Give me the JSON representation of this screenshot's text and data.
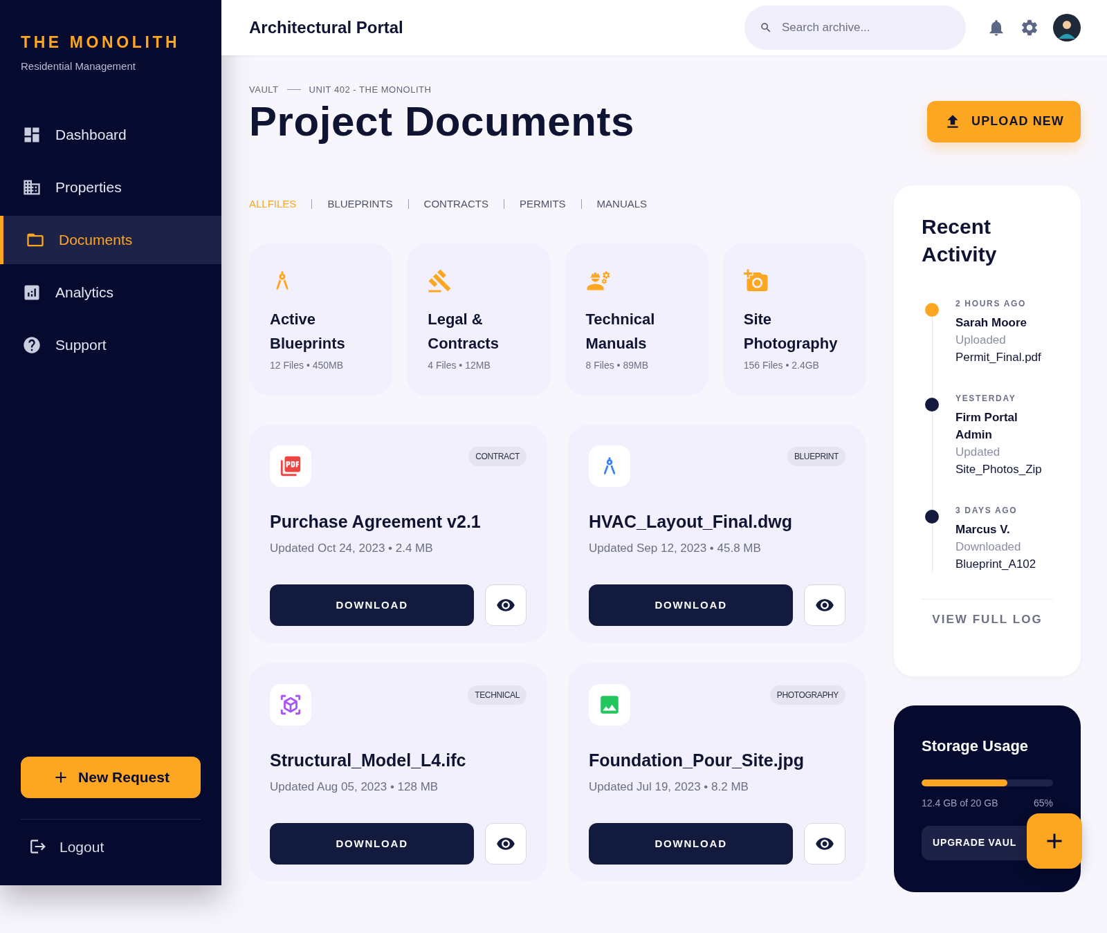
{
  "brand": {
    "title": "THE MONOLITH",
    "subtitle": "Residential Management"
  },
  "nav": [
    {
      "label": "Dashboard",
      "kind": "dashboard",
      "selected": false
    },
    {
      "label": "Properties",
      "kind": "properties",
      "selected": false
    },
    {
      "label": "Documents",
      "kind": "documents",
      "selected": true
    },
    {
      "label": "Analytics",
      "kind": "analytics",
      "selected": false
    },
    {
      "label": "Support",
      "kind": "support",
      "selected": false
    }
  ],
  "new_request": "New Request",
  "logout": "Logout",
  "header": {
    "title": "Architectural Portal",
    "search": {
      "placeholder": "Search archive..."
    }
  },
  "breadcrumb": [
    "VAULT",
    "UNIT 402 - THE MONOLITH"
  ],
  "page_title": "Project Documents",
  "upload_button": "UPLOAD NEW",
  "filters": [
    {
      "label": "ALLFILES",
      "selected": true
    },
    {
      "label": "BLUEPRINTS",
      "selected": false
    },
    {
      "label": "CONTRACTS",
      "selected": false
    },
    {
      "label": "PERMITS",
      "selected": false
    },
    {
      "label": "MANUALS",
      "selected": false
    }
  ],
  "categories": [
    {
      "kind": "blueprint",
      "title": "Active Blueprints",
      "meta": "12 Files • 450MB"
    },
    {
      "kind": "legal",
      "title": "Legal & Contracts",
      "meta": "4 Files • 12MB"
    },
    {
      "kind": "technical",
      "title": "Technical Manuals",
      "meta": "8 Files • 89MB"
    },
    {
      "kind": "photo",
      "title": "Site Photography",
      "meta": "156 Files • 2.4GB"
    }
  ],
  "documents": [
    {
      "kind": "pdf",
      "tag": "CONTRACT",
      "name": "Purchase Agreement v2.1",
      "meta": "Updated Oct 24, 2023 • 2.4 MB",
      "action": "DOWNLOAD"
    },
    {
      "kind": "blueprint",
      "tag": "BLUEPRINT",
      "name": "HVAC_Layout_Final.dwg",
      "meta": "Updated Sep 12, 2023 • 45.8 MB",
      "action": "DOWNLOAD"
    },
    {
      "kind": "model",
      "tag": "TECHNICAL",
      "name": "Structural_Model_L4.ifc",
      "meta": "Updated Aug 05, 2023 • 128 MB",
      "action": "DOWNLOAD"
    },
    {
      "kind": "image",
      "tag": "PHOTOGRAPHY",
      "name": "Foundation_Pour_Site.jpg",
      "meta": "Updated Jul 19, 2023 • 8.2 MB",
      "action": "DOWNLOAD"
    }
  ],
  "recent_activity": {
    "title": "Recent Activity",
    "items": [
      {
        "time": "2 HOURS AGO",
        "user": "Sarah Moore",
        "action": "Uploaded",
        "file": "Permit_Final.pdf",
        "color": "#fca622"
      },
      {
        "time": "YESTERDAY",
        "user": "Firm Portal Admin",
        "action": "Updated",
        "file": "Site_Photos_Zip",
        "color": "#141a3d"
      },
      {
        "time": "3 DAYS AGO",
        "user": "Marcus V.",
        "action": "Downloaded",
        "file": "Blueprint_A102",
        "color": "#141a3d"
      }
    ],
    "link": "VIEW FULL LOG"
  },
  "storage": {
    "title": "Storage Usage",
    "level": 0.65,
    "used": "12.4 GB of 20 GB",
    "percent": "65%",
    "button": "UPGRADE VAUL"
  }
}
